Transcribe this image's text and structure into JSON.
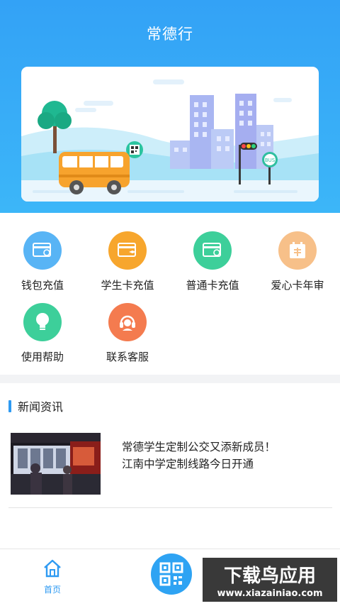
{
  "app": {
    "title": "常德行"
  },
  "services": [
    {
      "label": "钱包充值",
      "icon": "wallet-card-icon",
      "color": "#58b4f5"
    },
    {
      "label": "学生卡充值",
      "icon": "student-card-icon",
      "color": "#f7a62d"
    },
    {
      "label": "普通卡充值",
      "icon": "normal-card-icon",
      "color": "#3dcf9a"
    },
    {
      "label": "爱心卡年审",
      "icon": "calendar-review-icon",
      "color": "#f7c089"
    },
    {
      "label": "使用帮助",
      "icon": "lightbulb-icon",
      "color": "#3dcf9a"
    },
    {
      "label": "联系客服",
      "icon": "headset-icon",
      "color": "#f47b4f"
    }
  ],
  "banner": {
    "bus_sign": "BUS"
  },
  "news": {
    "section_title": "新闻资讯",
    "items": [
      {
        "line1": "常德学生定制公交又添新成员！",
        "line2": "江南中学定制线路今日开通"
      }
    ]
  },
  "tabbar": {
    "home_label": "首页"
  },
  "watermark": {
    "title": "下载鸟应用",
    "url": "www.xiazainiao.com"
  },
  "colors": {
    "accent": "#2e9af2",
    "header": "#33a2f6"
  }
}
